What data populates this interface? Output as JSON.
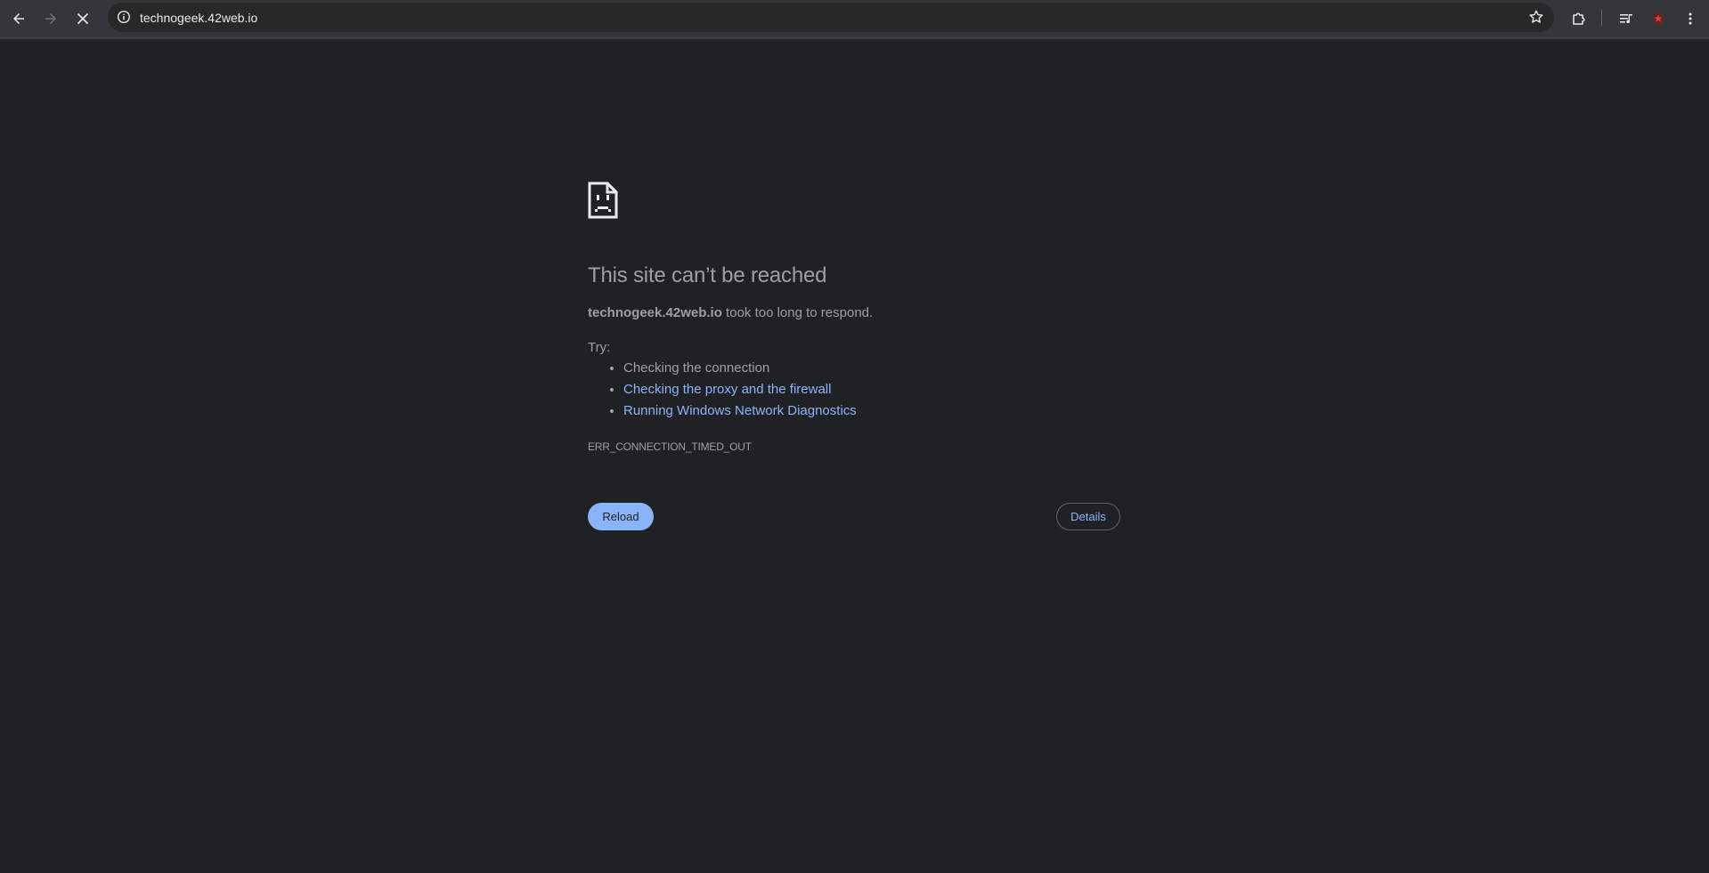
{
  "browser": {
    "url": "technogeek.42web.io",
    "back_icon": "arrow-left-icon",
    "forward_icon": "arrow-right-icon",
    "stop_icon": "close-icon",
    "site_info_icon": "info-circle-icon",
    "bookmark_icon": "star-outline-icon",
    "extensions_icon": "puzzle-icon",
    "media_icon": "playlist-music-icon",
    "profile_icon": "profile-avatar-icon",
    "menu_icon": "kebab-menu-icon"
  },
  "error_page": {
    "icon": "sad-document-icon",
    "title": "This site can’t be reached",
    "host": "technogeek.42web.io",
    "description_suffix": " took too long to respond.",
    "try_label": "Try:",
    "suggestions": [
      {
        "label": "Checking the connection",
        "is_link": false
      },
      {
        "label": "Checking the proxy and the firewall",
        "is_link": true
      },
      {
        "label": "Running Windows Network Diagnostics",
        "is_link": true
      }
    ],
    "error_code": "ERR_CONNECTION_TIMED_OUT",
    "reload_label": "Reload",
    "details_label": "Details"
  },
  "colors": {
    "page_bg": "#202124",
    "toolbar_bg": "#35363a",
    "text": "#9aa0a6",
    "link": "#8ab4f8",
    "primary_button": "#8ab4f8"
  }
}
